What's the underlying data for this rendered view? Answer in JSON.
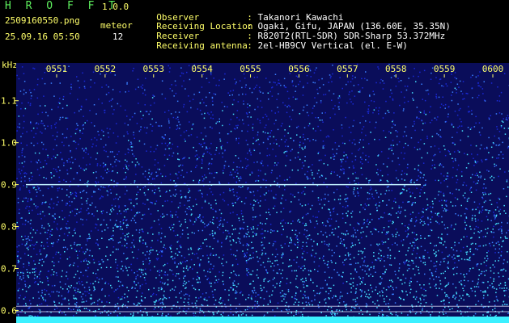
{
  "header": {
    "app_title": "H R O F F T",
    "app_version": "1.0.0",
    "file_name": "2509160550.png",
    "timestamp": "25.09.16 05:50",
    "mode_label": "meteor",
    "count_value": "12",
    "meta": [
      {
        "key": "Observer",
        "value": "Takanori Kawachi"
      },
      {
        "key": "Receiving Location",
        "value": "Ogaki, Gifu, JAPAN (136.60E, 35.35N)"
      },
      {
        "key": "Receiver",
        "value": "R820T2(RTL-SDR) SDR-Sharp 53.372MHz"
      },
      {
        "key": "Receiving antenna",
        "value": "2el-HB9CV Vertical (el. E-W)"
      }
    ],
    "separator": ":"
  },
  "chart_data": {
    "type": "heatmap",
    "title": "",
    "xlabel": "",
    "ylabel": "kHz",
    "x_tick_labels": [
      "0551",
      "0552",
      "0553",
      "0554",
      "0555",
      "0556",
      "0557",
      "0558",
      "0559",
      "0600"
    ],
    "y_tick_labels": [
      "1.1",
      "1.0",
      "0.9",
      "0.8",
      "0.7",
      "0.6"
    ],
    "y_ticks": [
      1.1,
      1.0,
      0.9,
      0.8,
      0.7,
      0.6
    ],
    "ylim": [
      0.57,
      1.19
    ],
    "xlim": [
      "05:50",
      "06:00"
    ],
    "carrier_line_khz": 0.9,
    "reference_lines_khz": [
      0.61,
      0.597,
      0.583
    ],
    "colors": {
      "background": "#0a0d5a",
      "noise_low": "#1a2ad8",
      "noise_mid": "#3a80ff",
      "noise_high": "#46e0ff",
      "carrier": "#c0f0ff",
      "axis_labels": "#ffff6a",
      "reference_line": "#e8e8ff",
      "baseline": "#3cf0ff"
    }
  }
}
